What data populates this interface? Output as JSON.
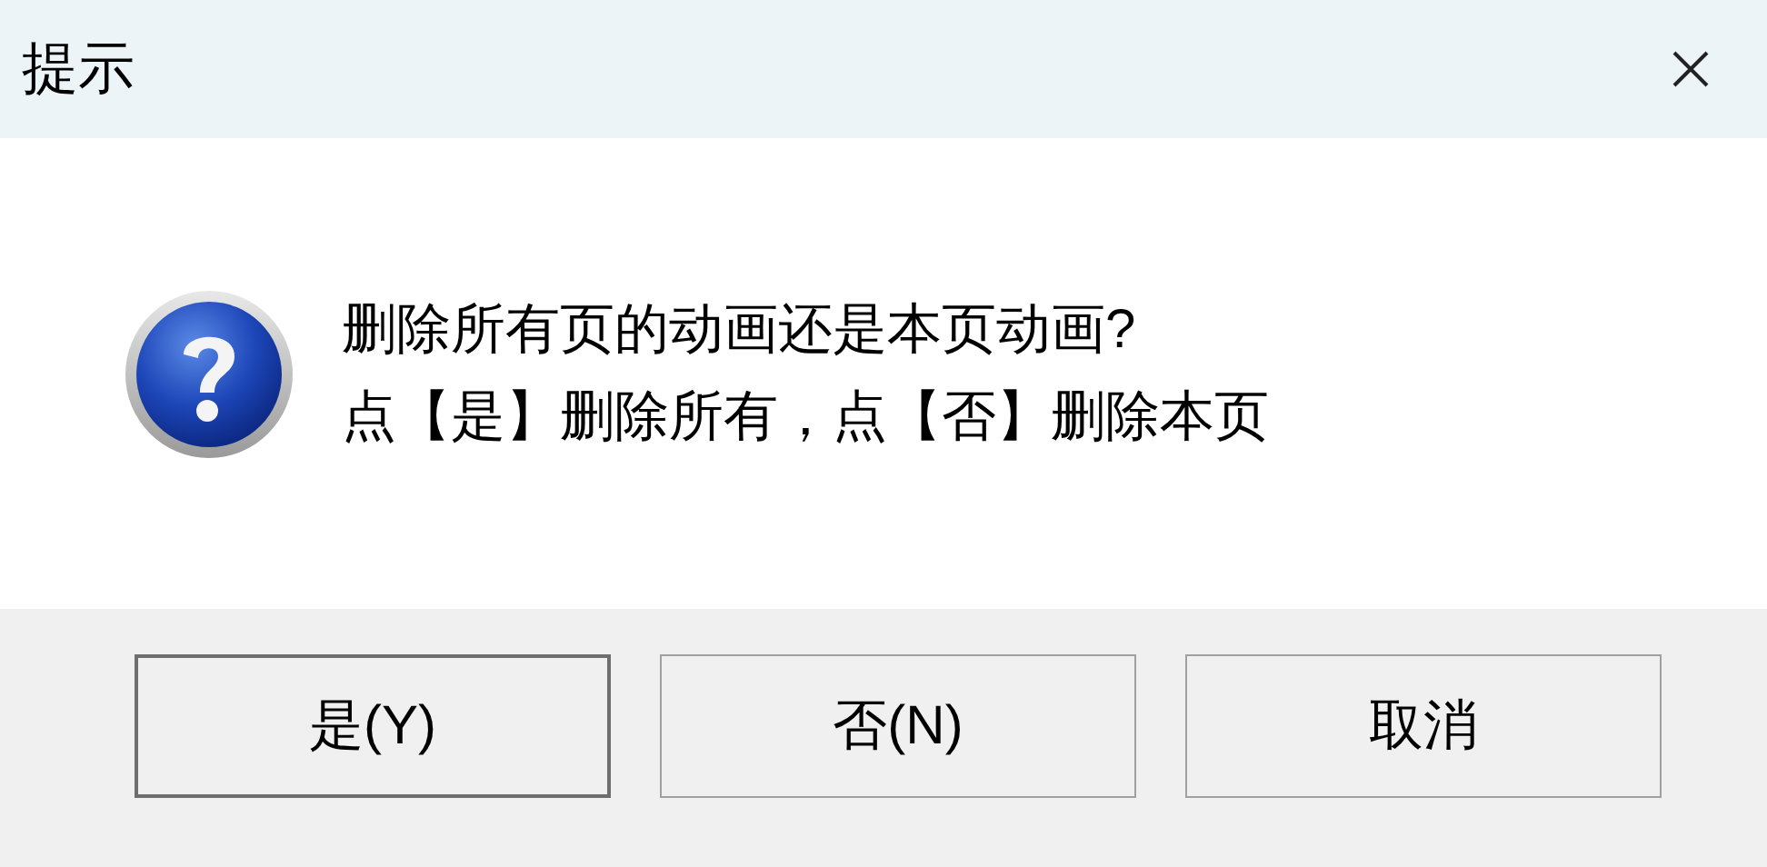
{
  "window": {
    "title": "提示"
  },
  "message": {
    "lines": [
      "删除所有页的动画还是本页动画?",
      "点【是】删除所有，点【否】删除本页"
    ]
  },
  "buttons": [
    {
      "label": "是(Y)",
      "default": true
    },
    {
      "label": "否(N)",
      "default": false
    },
    {
      "label": "取消",
      "default": false
    }
  ]
}
